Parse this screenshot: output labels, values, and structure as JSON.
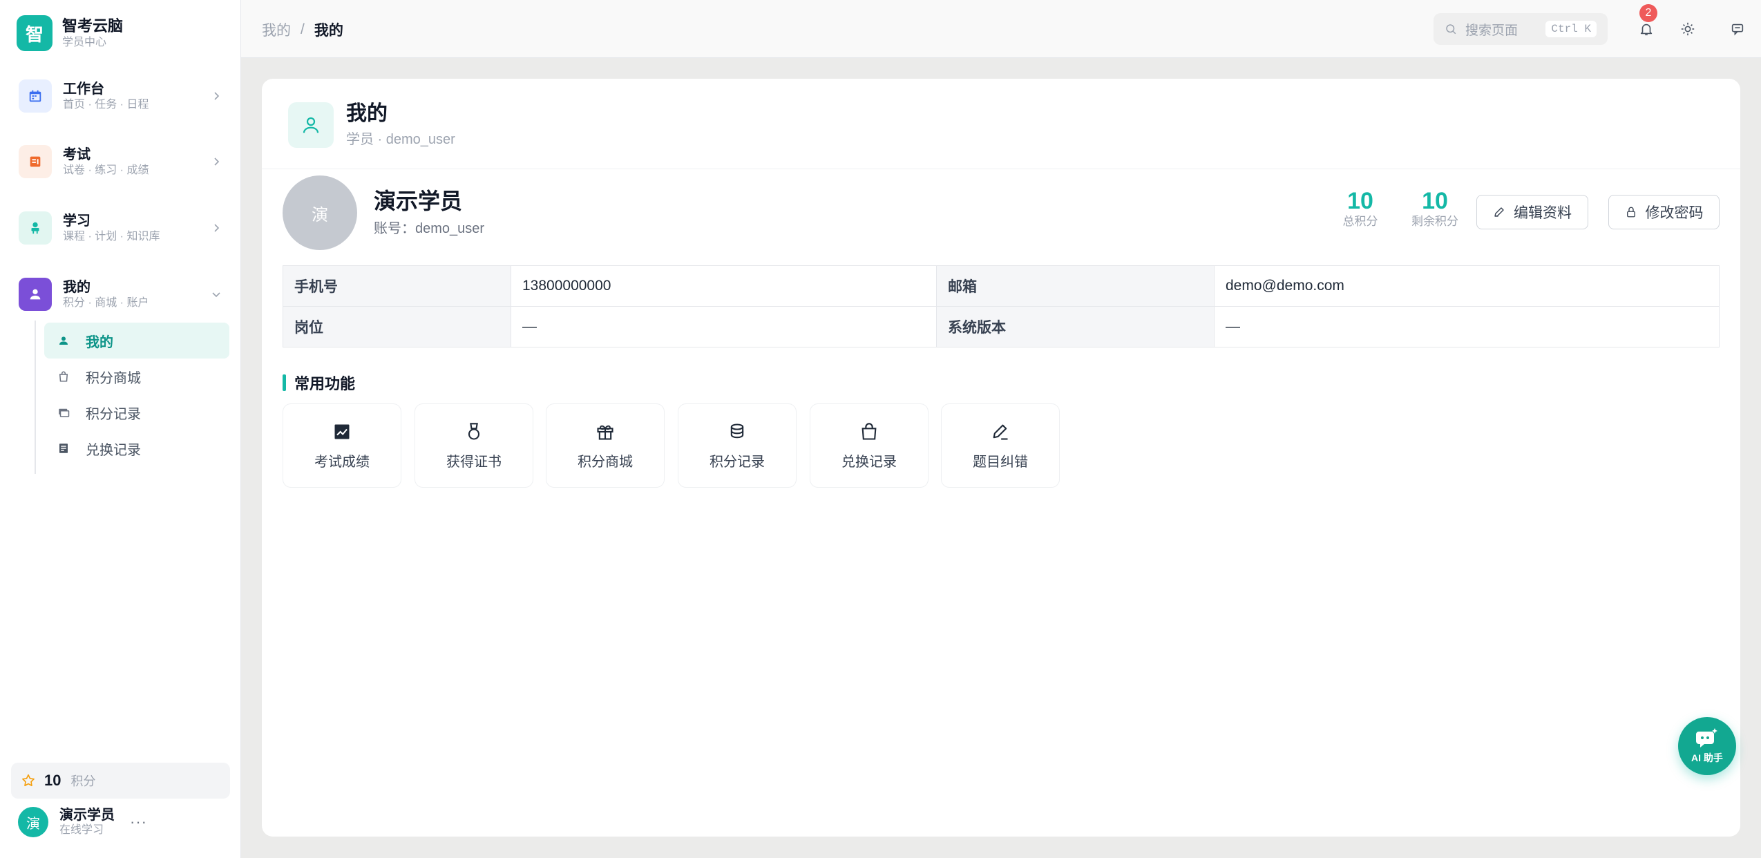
{
  "brand": {
    "title": "智考云脑",
    "subtitle": "学员中心",
    "logo": "智"
  },
  "sidebar": {
    "groups": [
      {
        "title": "工作台",
        "subtitle": "首页 · 任务 · 日程",
        "icon": "calendar-icon"
      },
      {
        "title": "考试",
        "subtitle": "试卷 · 练习 · 成绩",
        "icon": "exam-icon"
      },
      {
        "title": "学习",
        "subtitle": "课程 · 计划 · 知识库",
        "icon": "study-icon"
      },
      {
        "title": "我的",
        "subtitle": "积分 · 商城 · 账户",
        "icon": "user-icon"
      }
    ],
    "subitems": [
      {
        "label": "我的",
        "icon": "user-icon"
      },
      {
        "label": "积分商城",
        "icon": "bag-icon"
      },
      {
        "label": "积分记录",
        "icon": "card-icon"
      },
      {
        "label": "兑换记录",
        "icon": "receipt-icon"
      }
    ],
    "points": {
      "value": "10",
      "label": "积分"
    },
    "user": {
      "avatar": "演",
      "name": "演示学员",
      "status": "在线学习",
      "more": "···"
    }
  },
  "header": {
    "breadcrumb": [
      "我的",
      "我的"
    ],
    "breadcrumb_sep": "/",
    "search_placeholder": "搜索页面",
    "shortcut": "Ctrl K",
    "notification_count": "2"
  },
  "page": {
    "title": "我的",
    "subtitle": "学员 · demo_user"
  },
  "profile": {
    "avatar": "演",
    "name": "演示学员",
    "account": "账号：demo_user",
    "stats": [
      {
        "value": "10",
        "label": "总积分"
      },
      {
        "value": "10",
        "label": "剩余积分"
      }
    ],
    "edit_label": "编辑资料",
    "password_label": "修改密码"
  },
  "info": {
    "rows": [
      [
        {
          "k": "手机号",
          "v": "13800000000"
        },
        {
          "k": "邮箱",
          "v": "demo@demo.com"
        }
      ],
      [
        {
          "k": "岗位",
          "v": "—"
        },
        {
          "k": "系统版本",
          "v": "—"
        }
      ]
    ]
  },
  "functions": {
    "title": "常用功能",
    "items": [
      {
        "label": "考试成绩",
        "icon": "chart-icon"
      },
      {
        "label": "获得证书",
        "icon": "medal-icon"
      },
      {
        "label": "积分商城",
        "icon": "gift-icon"
      },
      {
        "label": "积分记录",
        "icon": "coins-icon"
      },
      {
        "label": "兑换记录",
        "icon": "shopping-bag-icon"
      },
      {
        "label": "题目纠错",
        "icon": "pen-icon"
      }
    ]
  },
  "ai": {
    "label": "AI 助手"
  },
  "colors": {
    "accent": "#14b8a6",
    "badge": "#ef5a5a"
  }
}
